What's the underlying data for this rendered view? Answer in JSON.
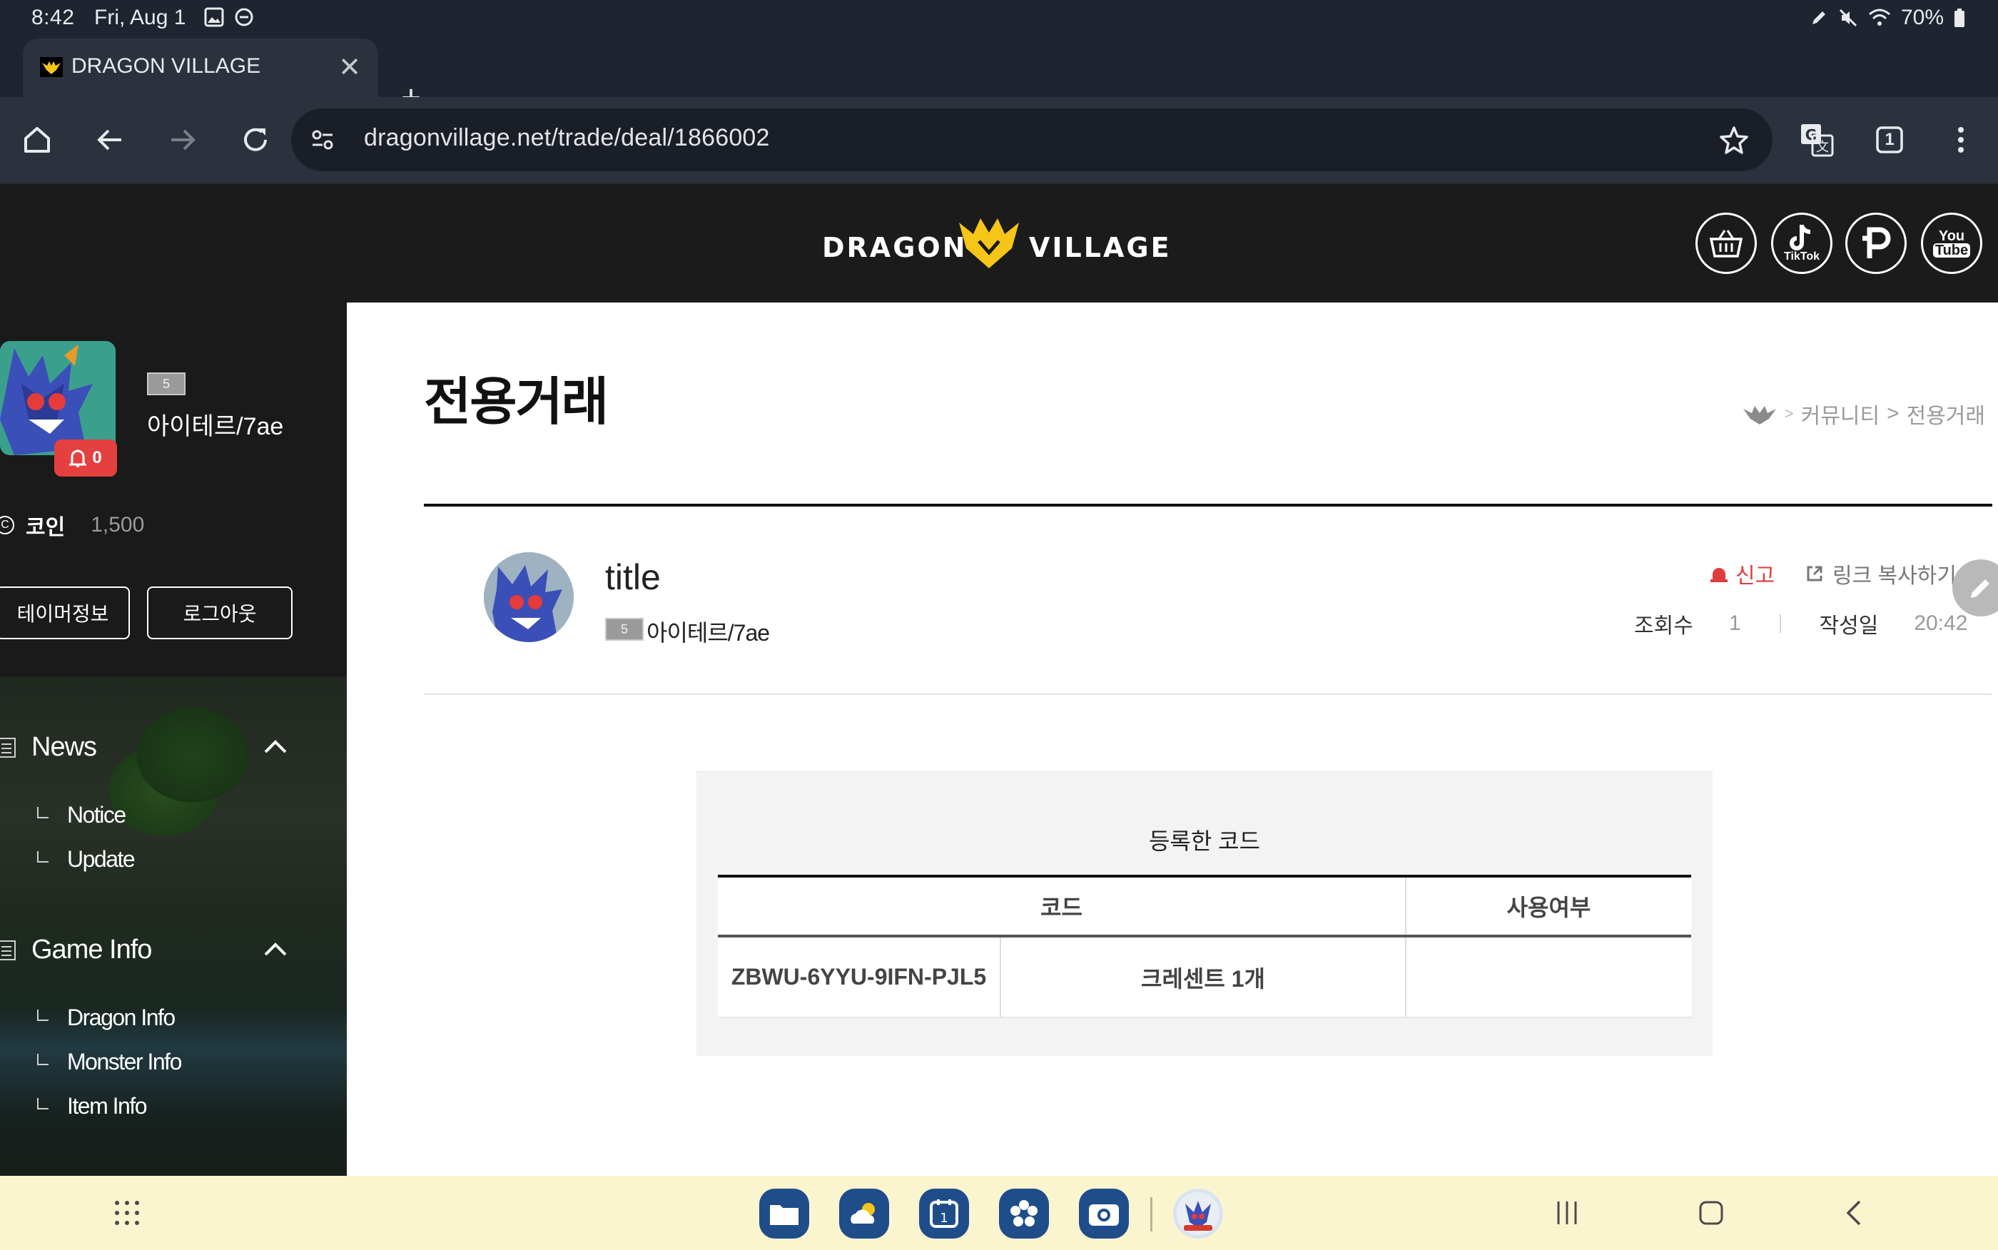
{
  "status_bar": {
    "time": "8:42",
    "date": "Fri, Aug 1",
    "battery": "70%"
  },
  "browser": {
    "tab_title": "DRAGON VILLAGE",
    "url": "dragonvillage.net/trade/deal/1866002",
    "tab_count": "1"
  },
  "site": {
    "logo_left": "DRAGON",
    "logo_right": "VILLAGE",
    "social": [
      "shop-basket-icon",
      "tiktok-icon",
      "pixiv-icon",
      "youtube-icon"
    ],
    "tiktok_label": "TikTok",
    "youtube_label_top": "You",
    "youtube_label_bottom": "Tube"
  },
  "sidebar": {
    "level": "5",
    "nickname": "아이테르/7ae",
    "notifications": "0",
    "coin_label": "코인",
    "coin_value": "1,500",
    "tamer_info_button": "테이머정보",
    "logout_button": "로그아웃",
    "sections": [
      {
        "title": "News",
        "items": [
          "Notice",
          "Update"
        ]
      },
      {
        "title": "Game Info",
        "items": [
          "Dragon Info",
          "Monster Info",
          "Item Info"
        ]
      }
    ]
  },
  "main": {
    "page_title": "전용거래",
    "breadcrumb": {
      "parent": "커뮤니티",
      "separator": ">",
      "current": "전용거래"
    },
    "post": {
      "title": "title",
      "author_level": "5",
      "author": "아이테르/7ae",
      "report_label": "신고",
      "copy_link_label": "링크 복사하기",
      "views_label": "조회수",
      "views_value": "1",
      "date_label": "작성일",
      "date_value": "20:42"
    },
    "codes": {
      "title": "등록한 코드",
      "headers": [
        "코드",
        "사용여부"
      ],
      "rows": [
        {
          "code": "ZBWU-6YYU-9IFN-PJL5",
          "item": "크레센트 1개",
          "used": ""
        }
      ]
    }
  },
  "colors": {
    "brand_yellow": "#f5c518",
    "report_red": "#e03c3c",
    "header_dark": "#1b1b1b"
  }
}
